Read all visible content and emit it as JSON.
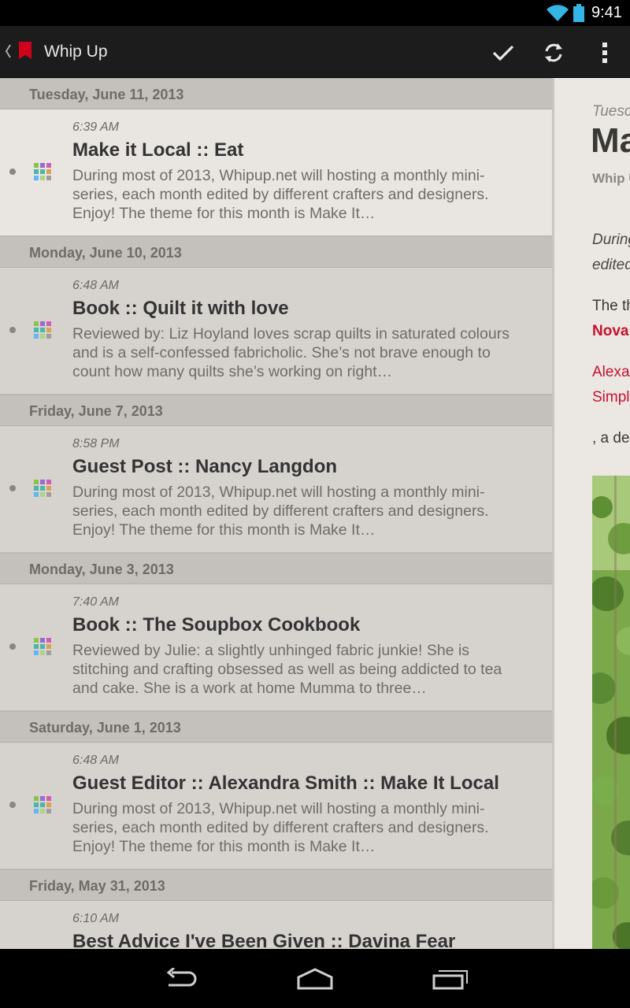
{
  "status_bar": {
    "time": "9:41",
    "icons": [
      "wifi-icon",
      "battery-icon"
    ]
  },
  "action_bar": {
    "title": "Whip Up",
    "actions": [
      "mark-read-icon",
      "refresh-icon",
      "overflow-menu-icon"
    ]
  },
  "list": {
    "groups": [
      {
        "date": "Tuesday, June 11, 2013",
        "items": [
          {
            "time": "6:39 AM",
            "title": "Make it Local :: Eat",
            "summary": "During most of 2013, Whipup.net will hosting a monthly mini-series, each month edited by different crafters and designers. Enjoy! The theme for this month is Make It…",
            "selected": true
          }
        ]
      },
      {
        "date": "Monday, June 10, 2013",
        "items": [
          {
            "time": "6:48 AM",
            "title": "Book :: Quilt it with love",
            "summary": "Reviewed by: Liz Hoyland loves scrap quilts in saturated colours and is a self-confessed fabricholic. She’s not brave enough to count how many quilts she’s working on right…"
          }
        ]
      },
      {
        "date": "Friday, June 7, 2013",
        "items": [
          {
            "time": "8:58 PM",
            "title": "Guest Post :: Nancy Langdon",
            "summary": "During most of 2013, Whipup.net will hosting a monthly mini-series, each month edited by different crafters and designers. Enjoy! The theme for this month is Make It…"
          }
        ]
      },
      {
        "date": "Monday, June 3, 2013",
        "items": [
          {
            "time": "7:40 AM",
            "title": "Book :: The Soupbox Cookbook",
            "summary": "Reviewed by Julie: a slightly unhinged fabric junkie! She is stitching and crafting obsessed as well as being addicted to tea and cake. She is a work at home Mumma to three…"
          }
        ]
      },
      {
        "date": "Saturday, June 1, 2013",
        "items": [
          {
            "time": "6:48 AM",
            "title": "Guest Editor :: Alexandra Smith :: Make It Local",
            "summary": "During most of 2013, Whipup.net will hosting a monthly mini-series, each month edited by different crafters and designers. Enjoy! The theme for this month is Make It…"
          }
        ]
      },
      {
        "date": "Friday, May 31, 2013",
        "items": [
          {
            "time": "6:10 AM",
            "title": "Best Advice I've Been Given :: Davina Fear",
            "summary": ""
          }
        ]
      }
    ]
  },
  "detail": {
    "date": "Tuesc",
    "title": "Ma",
    "source": "Whip U",
    "paragraph_1_line_1": "During",
    "paragraph_1_line_2": "edited",
    "paragraph_2_line_1": "The th",
    "paragraph_2_line_2": "Nova",
    "paragraph_3_line_1": "Alexa",
    "paragraph_3_line_2": "Simpl",
    "paragraph_4_line_1": ", a des"
  },
  "nav_bar": {
    "buttons": [
      "back-icon",
      "home-icon",
      "recent-apps-icon"
    ]
  },
  "colors": {
    "accent_red": "#c8102e",
    "action_bar": "#1c1c1c",
    "list_bg": "#d5d3d0",
    "selected_row": "#e9e6e2"
  }
}
